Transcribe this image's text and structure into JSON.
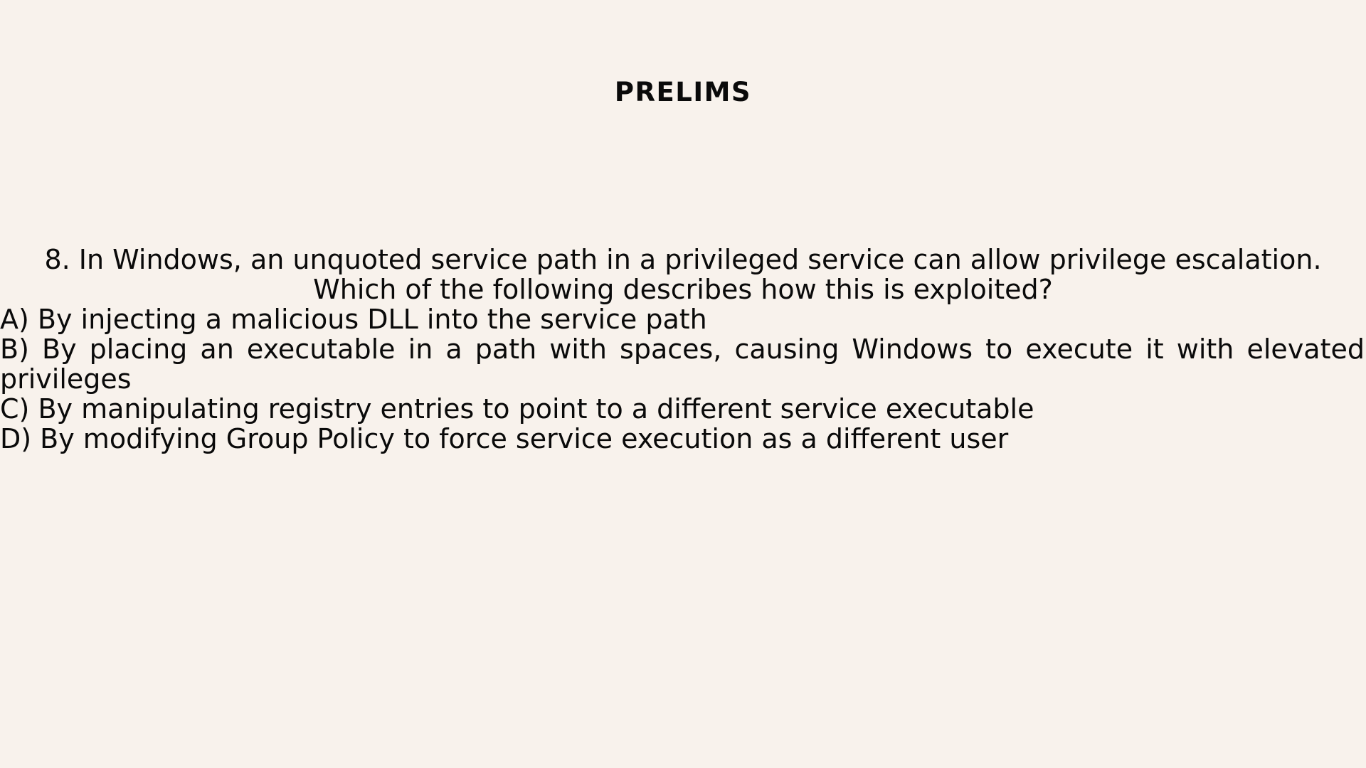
{
  "slide": {
    "title": "PRELIMS",
    "question": {
      "line1": "8. In Windows, an unquoted service path in a privileged service can allow privilege escalation.",
      "line2": "Which of the following describes how this is exploited?"
    },
    "options": [
      "A) By injecting a malicious DLL into the service path",
      "B) By placing an executable in a path with spaces, causing Windows to execute it with elevated privileges",
      "C) By manipulating registry entries to point to a different service executable",
      "D) By modifying Group Policy to force service execution as a different user"
    ],
    "colors": {
      "background": "#f8f2ec",
      "text": "#0a0a0a"
    }
  }
}
